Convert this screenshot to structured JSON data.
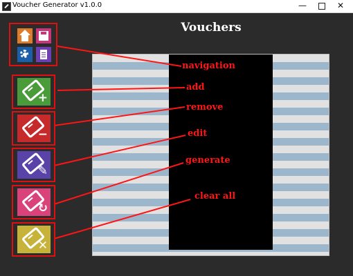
{
  "window": {
    "title": "Voucher Generator v1.0.0",
    "minimize": "—",
    "close": "✕"
  },
  "page": {
    "heading": "Vouchers"
  },
  "annotations": {
    "navigation": "navigation",
    "add": "add",
    "remove": "remove",
    "edit": "edit",
    "generate": "generate",
    "clear_all": "clear all"
  },
  "buttons": {
    "add_glyph": "+",
    "remove_glyph": "−",
    "edit_glyph": "✎",
    "generate_glyph": "↻",
    "clear_glyph": "✕"
  },
  "icons": [
    "home-icon",
    "save-icon",
    "settings-gear-icon",
    "document-icon",
    "voucher-add-icon",
    "voucher-remove-icon",
    "voucher-edit-icon",
    "voucher-generate-icon",
    "voucher-clear-icon"
  ],
  "colors": {
    "background": "#2b2b2b",
    "annotation": "#ff1515",
    "list_stripe": "#9cb6cc",
    "add": "#4a9b3a",
    "remove": "#c62a2a",
    "edit": "#5a43a8",
    "generate": "#d9437a",
    "clear": "#c7b33a"
  }
}
